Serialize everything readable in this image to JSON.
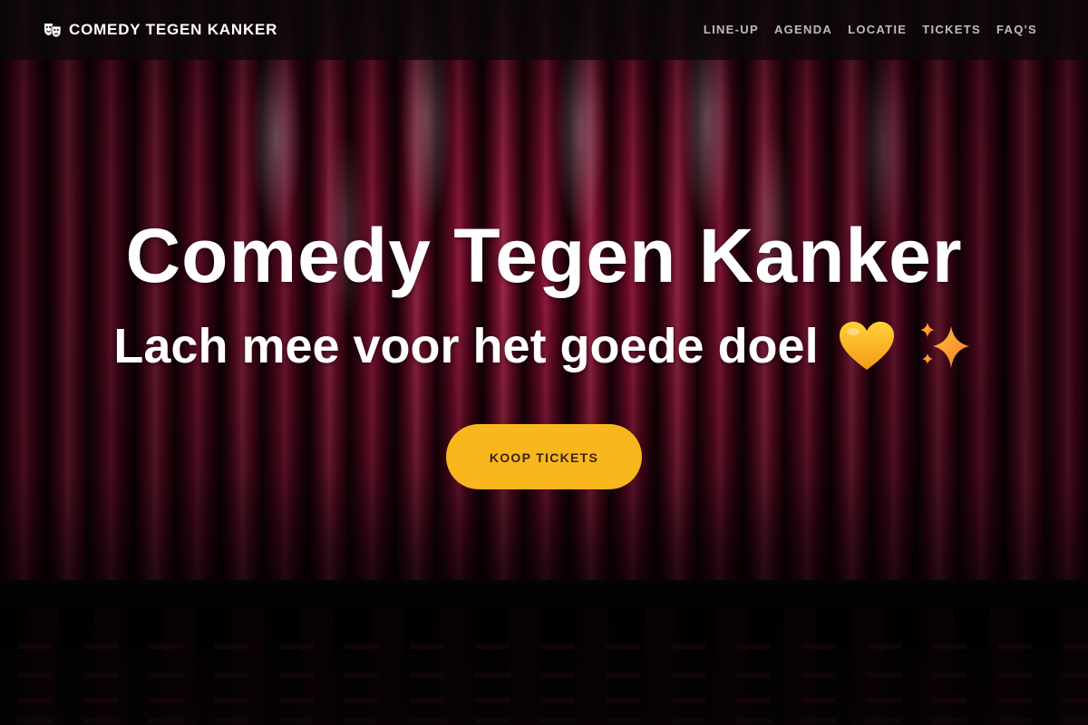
{
  "navbar": {
    "brand": "COMEDY TEGEN KANKER",
    "brand_icon": "theater-masks-icon",
    "links": [
      "LINE-UP",
      "AGENDA",
      "LOCATIE",
      "TICKETS",
      "FAQ'S"
    ]
  },
  "hero": {
    "title": "Comedy Tegen Kanker",
    "subtitle": "Lach mee voor het goede doel",
    "emojis": [
      "yellow-heart-icon",
      "sparkles-icon"
    ],
    "cta_label": "KOOP TICKETS"
  },
  "colors": {
    "accent": "#f8b71d",
    "curtain": "#8c0f33",
    "navbar_bg": "#0a080a"
  }
}
